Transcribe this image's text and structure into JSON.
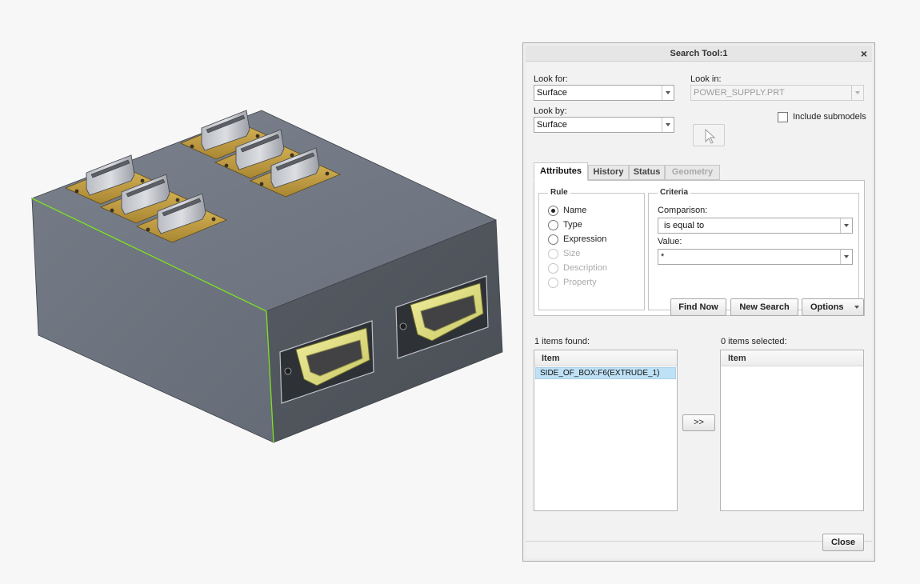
{
  "dialog": {
    "title": "Search Tool:1",
    "close_glyph": "×",
    "look_for_label": "Look for:",
    "look_for_value": "Surface",
    "look_in_label": "Look in:",
    "look_in_value": "POWER_SUPPLY.PRT",
    "look_by_label": "Look by:",
    "look_by_value": "Surface",
    "include_submodels_label": "Include submodels",
    "include_submodels_checked": false,
    "tabs": [
      {
        "label": "Attributes",
        "active": true,
        "enabled": true
      },
      {
        "label": "History",
        "active": false,
        "enabled": true
      },
      {
        "label": "Status",
        "active": false,
        "enabled": true
      },
      {
        "label": "Geometry",
        "active": false,
        "enabled": false
      }
    ],
    "rule": {
      "title": "Rule",
      "options": [
        {
          "label": "Name",
          "selected": true,
          "enabled": true
        },
        {
          "label": "Type",
          "selected": false,
          "enabled": true
        },
        {
          "label": "Expression",
          "selected": false,
          "enabled": true
        },
        {
          "label": "Size",
          "selected": false,
          "enabled": false
        },
        {
          "label": "Description",
          "selected": false,
          "enabled": false
        },
        {
          "label": "Property",
          "selected": false,
          "enabled": false
        }
      ]
    },
    "criteria": {
      "title": "Criteria",
      "comparison_label": "Comparison:",
      "comparison_value": "is equal to",
      "value_label": "Value:",
      "value_value": "*"
    },
    "buttons": {
      "find_now": "Find Now",
      "new_search": "New Search",
      "options": "Options",
      "transfer": ">>",
      "close": "Close"
    },
    "found": {
      "label": "1 items found:",
      "column": "Item",
      "items": [
        "SIDE_OF_BOX:F6(EXTRUDE_1)"
      ]
    },
    "selected": {
      "label": "0 items selected:",
      "column": "Item",
      "items": []
    }
  },
  "colors": {
    "model_top": "#727985",
    "model_left": "#6c737e",
    "model_front": "#4f545c",
    "highlight_edge": "#7fe321",
    "connector_gold": "#c9a544",
    "connector_yellow": "#e6e489",
    "selection_row": "#bfe1f5"
  }
}
